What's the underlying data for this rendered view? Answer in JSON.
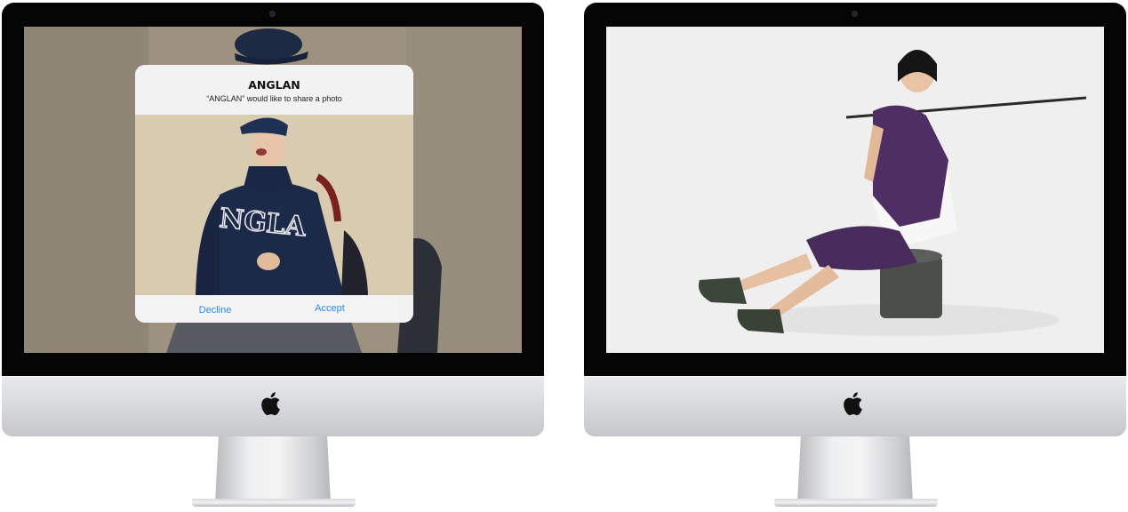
{
  "left_monitor": {
    "dialog": {
      "title": "ANGLAN",
      "message": "“ANGLAN” would like to share a photo",
      "decline_label": "Decline",
      "accept_label": "Accept",
      "button_color": "#2f8cf5"
    },
    "logo_icon": "apple-logo-icon"
  },
  "right_monitor": {
    "logo_icon": "apple-logo-icon"
  }
}
